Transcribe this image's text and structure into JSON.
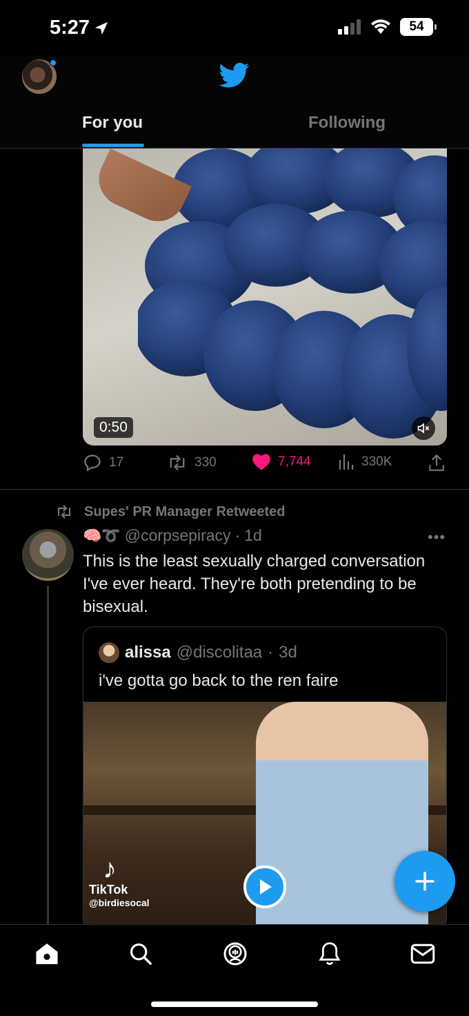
{
  "status_bar": {
    "time": "5:27",
    "battery": "54"
  },
  "header": {
    "tabs": [
      {
        "label": "For you",
        "active": true
      },
      {
        "label": "Following",
        "active": false
      }
    ]
  },
  "tweet_1": {
    "video_duration": "0:50",
    "replies": "17",
    "retweets": "330",
    "likes": "7,744",
    "views": "330K"
  },
  "tweet_2": {
    "retweet_context": "Supes' PR Manager Retweeted",
    "author_emoji": "🧠➰",
    "handle": "@corpsepiracy",
    "time": "1d",
    "text": "This is the least sexually charged conversation I've ever heard. They're both pretending to be bisexual.",
    "quoted": {
      "name": "alissa",
      "handle": "@discolitaa",
      "time": "3d",
      "text": "i've gotta go back to the ren faire",
      "video_watermark": {
        "brand": "TikTok",
        "user": "@birdiesocal"
      }
    }
  },
  "colors": {
    "accent": "#1d9bf0",
    "like": "#f91880",
    "muted": "#71767b",
    "text": "#e7e9ea"
  },
  "nav": {
    "icons": [
      "home-icon",
      "search-icon",
      "spaces-icon",
      "notifications-icon",
      "messages-icon"
    ]
  }
}
